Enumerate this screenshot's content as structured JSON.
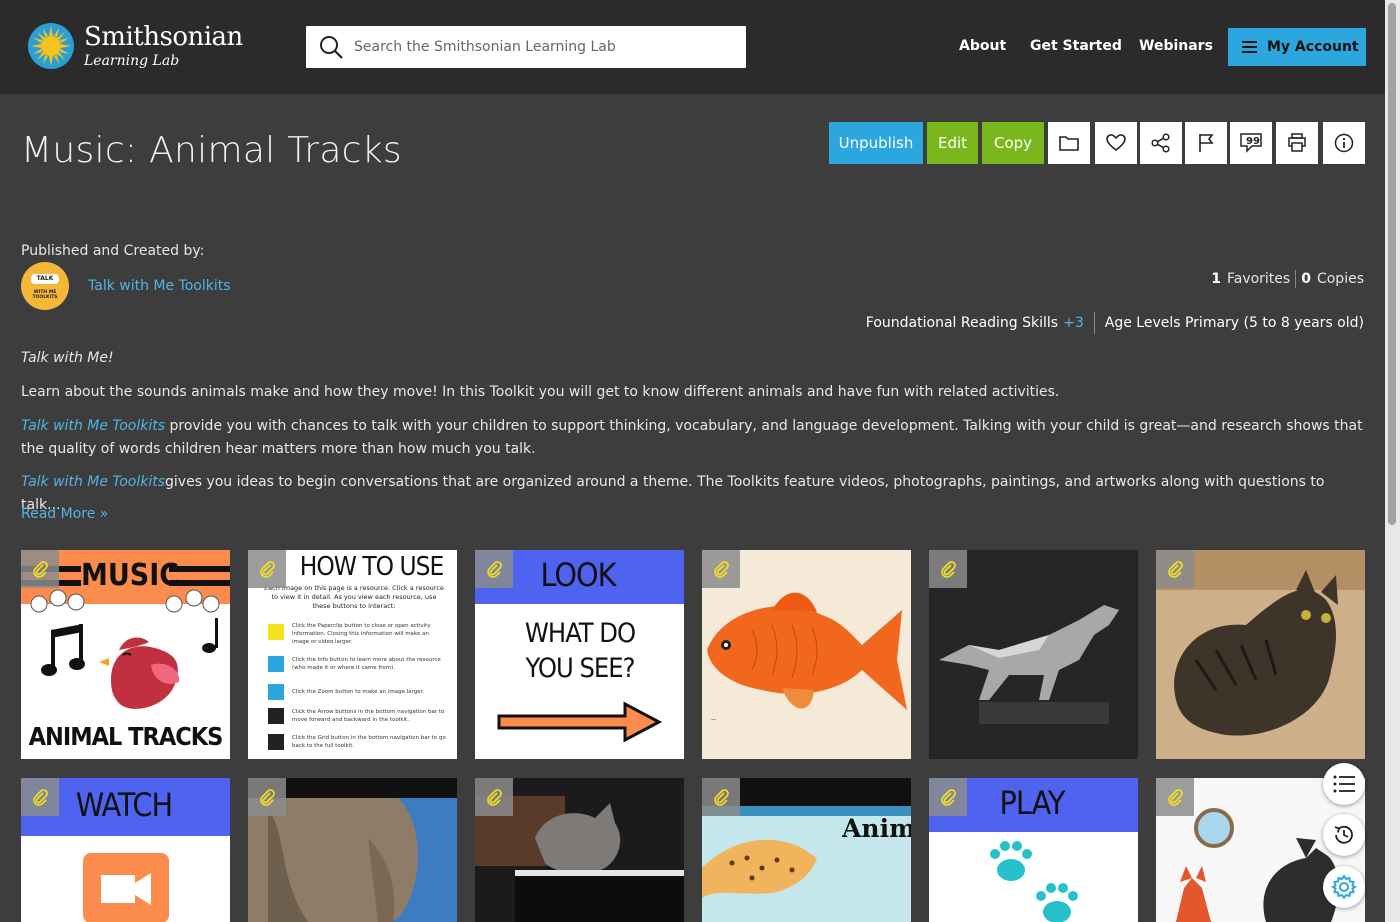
{
  "header": {
    "logo_name": "Smithsonian",
    "logo_sub": "Learning Lab",
    "search_placeholder": "Search the Smithsonian Learning Lab",
    "nav": [
      "About",
      "Get Started",
      "Webinars"
    ],
    "account_label": "My Account"
  },
  "page": {
    "title": "Music: Animal Tracks",
    "actions": {
      "unpublish": "Unpublish",
      "edit": "Edit",
      "copy": "Copy"
    },
    "icon_buttons": [
      "folder-icon",
      "heart-icon",
      "share-icon",
      "flag-icon",
      "quote-icon",
      "print-icon",
      "info-icon"
    ]
  },
  "meta": {
    "published_label": "Published and Created by:",
    "author": "Talk with Me Toolkits",
    "avatar_top": "TALK",
    "avatar_bottom": "WITH ME TOOLKITS",
    "favorites_count": "1",
    "favorites_label": "Favorites",
    "copies_count": "0",
    "copies_label": "Copies",
    "subject": "Foundational Reading Skills",
    "subject_more": "+3",
    "age_levels": "Age Levels Primary (5 to 8 years old)"
  },
  "description": {
    "heading": "Talk with Me!",
    "p1": "Learn about the sounds animals make and how they move! In this Toolkit you will get to know different animals and have fun with related activities.",
    "p2_link": "Talk with Me Toolkits",
    "p2_rest": " provide you with chances to talk with your children to support thinking, vocabulary, and language development. Talking with your child is great—and research shows that the quality of words children hear matters more than how much you talk.",
    "p3_link": "Talk with Me Toolkits",
    "p3_rest": "gives you ideas to begin conversations that are organized around a theme. The Toolkits feature videos, photographs, paintings, and artworks along with questions to talk...",
    "read_more": "Read More »"
  },
  "cards": {
    "music_title": "MUSIC",
    "music_sub": "ANIMAL TRACKS",
    "howto_title": "HOW TO USE",
    "howto_intro": "Each image on this page is a resource. Click a resource to view it in detail. As you view each resource, use these buttons to interact:",
    "howto_items": [
      "Click the Paperclip button to close or open activity information. Closing this information will make an image or video larger.",
      "Click the Info button to learn more about the resource (who made it or where it came from).",
      "Click the Zoom button to make an image larger.",
      "Click the Arrow buttons in the bottom navigation bar to move forward and backward in the toolkit.",
      "Click the Grid button in the bottom navigation bar to go back to the full toolkit."
    ],
    "look_title": "LOOK",
    "look_sub": "WHAT DO YOU SEE?",
    "watch_title": "WATCH",
    "play_title": "PLAY",
    "anim_title": "Animals on the Move"
  },
  "colors": {
    "accent_blue": "#2ba7dd",
    "accent_green": "#7ab71c",
    "header_bg": "#2b2b2b",
    "page_bg": "#3d3d3d",
    "card_orange": "#fb8c4e",
    "card_blue": "#4e63f0"
  }
}
